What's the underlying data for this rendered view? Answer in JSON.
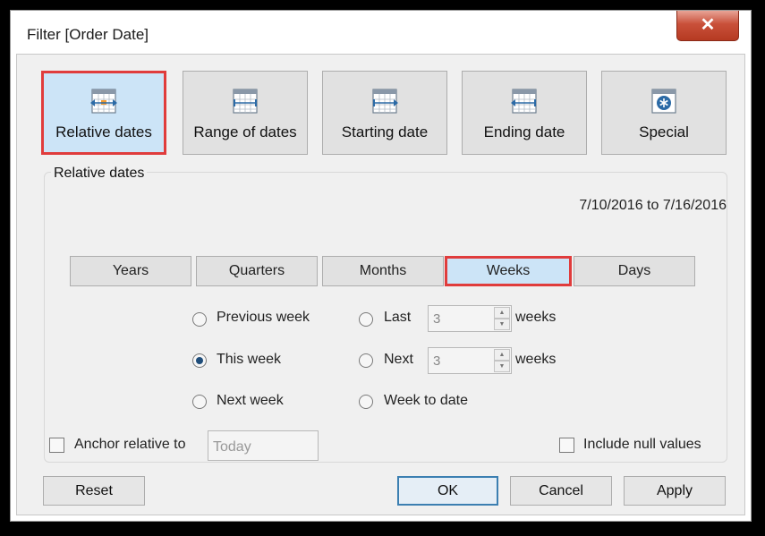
{
  "window": {
    "title": "Filter [Order Date]",
    "close_glyph": "✕"
  },
  "filter_types": [
    {
      "label": "Relative dates",
      "icon": "calendar-relative-icon",
      "selected": true
    },
    {
      "label": "Range of dates",
      "icon": "calendar-range-icon",
      "selected": false
    },
    {
      "label": "Starting date",
      "icon": "calendar-start-icon",
      "selected": false
    },
    {
      "label": "Ending date",
      "icon": "calendar-end-icon",
      "selected": false
    },
    {
      "label": "Special",
      "icon": "calendar-special-icon",
      "selected": false
    }
  ],
  "relative": {
    "group_title": "Relative dates",
    "range_text": "7/10/2016 to 7/16/2016",
    "units": [
      "Years",
      "Quarters",
      "Months",
      "Weeks",
      "Days"
    ],
    "selected_unit": "Weeks",
    "options": {
      "previous": "Previous week",
      "this": "This week",
      "next": "Next week",
      "last": "Last",
      "next_n": "Next",
      "to_date": "Week to date",
      "weeks_suffix": "weeks"
    },
    "selected_option": "This week",
    "last_value": "3",
    "next_value": "3",
    "anchor_label": "Anchor relative to",
    "anchor_value": "Today",
    "include_null_label": "Include null values"
  },
  "buttons": {
    "reset": "Reset",
    "ok": "OK",
    "cancel": "Cancel",
    "apply": "Apply"
  },
  "colors": {
    "selection_border": "#e03c3c",
    "selected_fill": "#cce4f7",
    "icon_blue": "#2b6aa6"
  }
}
